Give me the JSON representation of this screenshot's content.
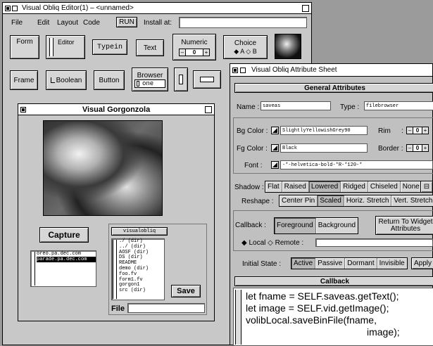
{
  "editor": {
    "title": "Visual Obliq Editor(1) – <unnamed>",
    "menu": [
      "File",
      "Edit",
      "Layout",
      "Code"
    ],
    "run_label": "RUN",
    "install_label": "Install at:",
    "palette": {
      "form": "Form",
      "editor": "Editor",
      "typein": "Typein",
      "text": "Text",
      "numeric": "Numeric",
      "numeric_value": "0",
      "choice": "Choice",
      "choice_a": "A",
      "choice_b": "B",
      "frame": "Frame",
      "boolean": "Boolean",
      "button": "Button",
      "browser": "Browser",
      "browser_item": "one"
    }
  },
  "gorgonzola": {
    "title": "Visual Gorgonzola",
    "capture": "Capture",
    "hosts": [
      "oreo.pa.dec.com",
      "parade.pa.dec.com"
    ],
    "browser_title": "visualobliq",
    "files": [
      "./ (dir)",
      "../ (dir)",
      "AOSF (dir)",
      "DS (dir)",
      "README",
      "demo (dir)",
      "foo.fv",
      "form1.fv",
      "gorgon1",
      "src (dir)"
    ],
    "save": "Save",
    "file_label": "File :"
  },
  "attr": {
    "title": "Visual Obliq Attribute Sheet",
    "general": "General Attributes",
    "name_label": "Name :",
    "name_value": "saveas",
    "type_label": "Type :",
    "type_value": "filebrowser",
    "bg_label": "Bg Color :",
    "bg_value": "SlightlyYellowishGrey90",
    "rim_label": "Rim",
    "fg_label": "Fg Color :",
    "fg_value": "Black",
    "border_label": "Border :",
    "font_label": "Font :",
    "font_value": "-*-helvetica-bold-*R-*120-*",
    "rim_value": "0",
    "border_value": "0",
    "shadow_label": "Shadow :",
    "shadow": [
      "Flat",
      "Raised",
      "Lowered",
      "Ridged",
      "Chiseled",
      "None"
    ],
    "reshape_label": "Reshape :",
    "reshape": [
      "Center Pin",
      "Scaled",
      "Horiz. Stretch",
      "Vert. Stretch"
    ],
    "callback_label": "Callback :",
    "foreground": "Foreground",
    "background": "Background",
    "return": "Return To Widget Attributes",
    "local": "Local",
    "remote": "Remote :",
    "initial_label": "Initial State :",
    "initial": [
      "Active",
      "Passive",
      "Dormant",
      "Invisible"
    ],
    "apply": "Apply",
    "callback_title": "Callback",
    "code": [
      "let fname =  SELF.saveas.getText();",
      "let image = SELF.vid.getImage();",
      "volibLocal.saveBinFile(fname,",
      "image);"
    ]
  }
}
